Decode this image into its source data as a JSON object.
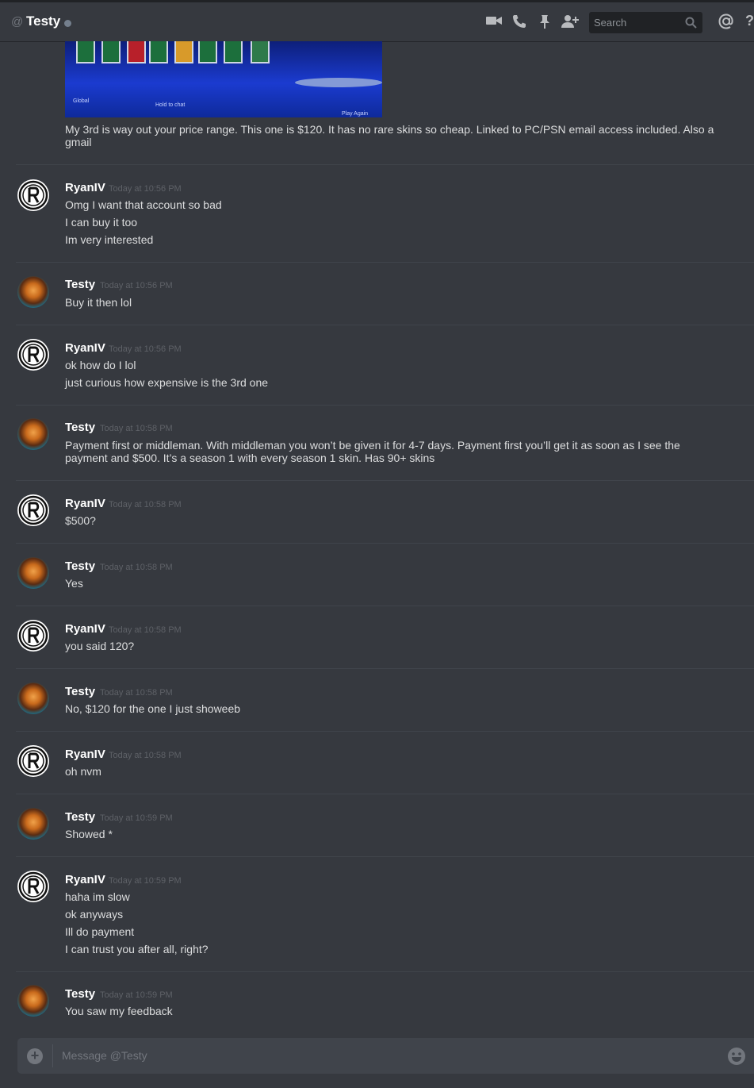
{
  "header": {
    "at_symbol": "@",
    "title": "Testy",
    "search_placeholder": "Search",
    "icons": [
      "video-icon",
      "phone-icon",
      "pin-icon",
      "add-friend-icon",
      "search-icon",
      "mention-icon",
      "help-icon"
    ],
    "help_glyph": "?"
  },
  "attachment": {
    "labels": {
      "left": "Global",
      "middle": "Hold to chat",
      "right": "Play Again"
    },
    "caption": "My 3rd is way out your price range. This one is $120. It has no rare skins so cheap. Linked to PC/PSN email access included. Also a gmail"
  },
  "messages": [
    {
      "author": "RyanIV",
      "time": "Today at 10:56 PM",
      "lines": [
        "Omg I want that account so bad",
        "I can buy it too",
        "Im very interested"
      ]
    },
    {
      "author": "Testy",
      "time": "Today at 10:56 PM",
      "lines": [
        "Buy it then lol"
      ]
    },
    {
      "author": "RyanIV",
      "time": "Today at 10:56 PM",
      "lines": [
        "ok how do I lol",
        "just curious how expensive is the 3rd one"
      ]
    },
    {
      "author": "Testy",
      "time": "Today at 10:58 PM",
      "lines": [
        "Payment first or middleman. With middleman you won’t be given it for 4-7 days. Payment first you’ll get it as soon as I see the payment and $500. It’s a season 1 with every season 1 skin. Has 90+ skins"
      ]
    },
    {
      "author": "RyanIV",
      "time": "Today at 10:58 PM",
      "lines": [
        "$500?"
      ]
    },
    {
      "author": "Testy",
      "time": "Today at 10:58 PM",
      "lines": [
        "Yes"
      ]
    },
    {
      "author": "RyanIV",
      "time": "Today at 10:58 PM",
      "lines": [
        "you said 120?"
      ]
    },
    {
      "author": "Testy",
      "time": "Today at 10:58 PM",
      "lines": [
        "No, $120 for the one I just showeeb"
      ]
    },
    {
      "author": "RyanIV",
      "time": "Today at 10:58 PM",
      "lines": [
        "oh nvm"
      ]
    },
    {
      "author": "Testy",
      "time": "Today at 10:59 PM",
      "lines": [
        "Showed *"
      ]
    },
    {
      "author": "RyanIV",
      "time": "Today at 10:59 PM",
      "lines": [
        "haha im slow",
        "ok anyways",
        "Ill do payment",
        "I can trust you after all, right?"
      ]
    },
    {
      "author": "Testy",
      "time": "Today at 10:59 PM",
      "lines": [
        "You saw my feedback"
      ]
    }
  ],
  "composer": {
    "placeholder": "Message @Testy"
  },
  "colors": {
    "background": "#36393f",
    "header_text": "#ffffff",
    "timestamp": "#5e6167",
    "body_text": "#dcddde",
    "input_bg": "#40444b"
  }
}
